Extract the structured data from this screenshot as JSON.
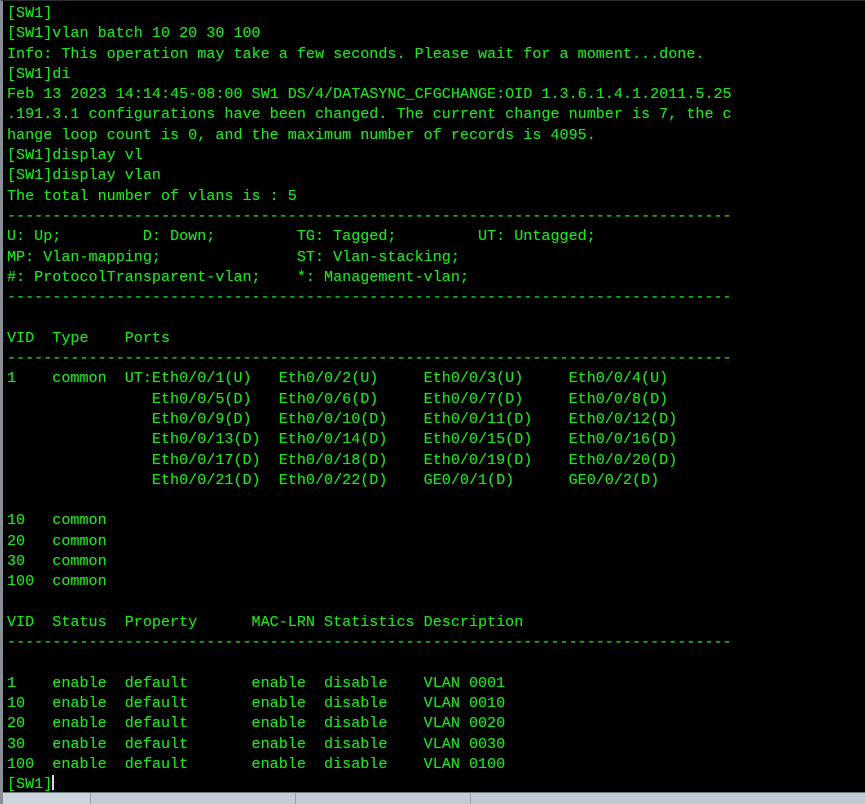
{
  "terminal": {
    "prompt": "[SW1]",
    "theme": {
      "background": "#000000",
      "foreground": "#22e022",
      "cursor": "#cfd6dd",
      "status_bar": "#b9c4d0"
    },
    "lines": [
      "[SW1]",
      "[SW1]vlan batch 10 20 30 100",
      "Info: This operation may take a few seconds. Please wait for a moment...done.",
      "[SW1]di",
      "Feb 13 2023 14:14:45-08:00 SW1 DS/4/DATASYNC_CFGCHANGE:OID 1.3.6.1.4.1.2011.5.25",
      ".191.3.1 configurations have been changed. The current change number is 7, the c",
      "hange loop count is 0, and the maximum number of records is 4095.",
      "[SW1]display vl",
      "[SW1]display vlan",
      "The total number of vlans is : 5",
      "--------------------------------------------------------------------------------",
      "U: Up;         D: Down;         TG: Tagged;         UT: Untagged;",
      "MP: Vlan-mapping;               ST: Vlan-stacking;",
      "#: ProtocolTransparent-vlan;    *: Management-vlan;",
      "--------------------------------------------------------------------------------",
      "",
      "VID  Type    Ports",
      "--------------------------------------------------------------------------------",
      "1    common  UT:Eth0/0/1(U)   Eth0/0/2(U)     Eth0/0/3(U)     Eth0/0/4(U)",
      "                Eth0/0/5(D)   Eth0/0/6(D)     Eth0/0/7(D)     Eth0/0/8(D)",
      "                Eth0/0/9(D)   Eth0/0/10(D)    Eth0/0/11(D)    Eth0/0/12(D)",
      "                Eth0/0/13(D)  Eth0/0/14(D)    Eth0/0/15(D)    Eth0/0/16(D)",
      "                Eth0/0/17(D)  Eth0/0/18(D)    Eth0/0/19(D)    Eth0/0/20(D)",
      "                Eth0/0/21(D)  Eth0/0/22(D)    GE0/0/1(D)      GE0/0/2(D)",
      "",
      "10   common",
      "20   common",
      "30   common",
      "100  common",
      "",
      "VID  Status  Property      MAC-LRN Statistics Description",
      "--------------------------------------------------------------------------------",
      "",
      "1    enable  default       enable  disable    VLAN 0001",
      "10   enable  default       enable  disable    VLAN 0010",
      "20   enable  default       enable  disable    VLAN 0020",
      "30   enable  default       enable  disable    VLAN 0030",
      "100  enable  default       enable  disable    VLAN 0100"
    ],
    "final_prompt": "[SW1]"
  },
  "command_session": {
    "commands_entered": [
      "vlan batch 10 20 30 100",
      "di",
      "display vl",
      "display vlan"
    ],
    "info_message": "Info: This operation may take a few seconds. Please wait for a moment...done.",
    "log_event": {
      "timestamp": "Feb 13 2023 14:14:45-08:00",
      "device": "SW1",
      "module": "DS/4/DATASYNC_CFGCHANGE",
      "oid": "1.3.6.1.4.1.2011.5.25.191.3.1",
      "change_number": "7",
      "change_loop_count": "0",
      "max_records": "4095"
    },
    "vlan_summary": {
      "total_label": "The total number of vlans is : 5",
      "total_count": "5"
    },
    "legend": [
      {
        "code": "U",
        "meaning": "Up"
      },
      {
        "code": "D",
        "meaning": "Down"
      },
      {
        "code": "TG",
        "meaning": "Tagged"
      },
      {
        "code": "UT",
        "meaning": "Untagged"
      },
      {
        "code": "MP",
        "meaning": "Vlan-mapping"
      },
      {
        "code": "ST",
        "meaning": "Vlan-stacking"
      },
      {
        "code": "#",
        "meaning": "ProtocolTransparent-vlan"
      },
      {
        "code": "*",
        "meaning": "Management-vlan"
      }
    ],
    "ports_table": {
      "headers": [
        "VID",
        "Type",
        "Ports"
      ],
      "rows": [
        {
          "vid": "1",
          "type": "common",
          "tag": "UT:",
          "ports": [
            "Eth0/0/1(U)",
            "Eth0/0/2(U)",
            "Eth0/0/3(U)",
            "Eth0/0/4(U)",
            "Eth0/0/5(D)",
            "Eth0/0/6(D)",
            "Eth0/0/7(D)",
            "Eth0/0/8(D)",
            "Eth0/0/9(D)",
            "Eth0/0/10(D)",
            "Eth0/0/11(D)",
            "Eth0/0/12(D)",
            "Eth0/0/13(D)",
            "Eth0/0/14(D)",
            "Eth0/0/15(D)",
            "Eth0/0/16(D)",
            "Eth0/0/17(D)",
            "Eth0/0/18(D)",
            "Eth0/0/19(D)",
            "Eth0/0/20(D)",
            "Eth0/0/21(D)",
            "Eth0/0/22(D)",
            "GE0/0/1(D)",
            "GE0/0/2(D)"
          ]
        },
        {
          "vid": "10",
          "type": "common",
          "tag": "",
          "ports": []
        },
        {
          "vid": "20",
          "type": "common",
          "tag": "",
          "ports": []
        },
        {
          "vid": "30",
          "type": "common",
          "tag": "",
          "ports": []
        },
        {
          "vid": "100",
          "type": "common",
          "tag": "",
          "ports": []
        }
      ]
    },
    "status_table": {
      "headers": [
        "VID",
        "Status",
        "Property",
        "MAC-LRN",
        "Statistics",
        "Description"
      ],
      "rows": [
        {
          "vid": "1",
          "status": "enable",
          "property": "default",
          "mac_lrn": "enable",
          "statistics": "disable",
          "description": "VLAN 0001"
        },
        {
          "vid": "10",
          "status": "enable",
          "property": "default",
          "mac_lrn": "enable",
          "statistics": "disable",
          "description": "VLAN 0010"
        },
        {
          "vid": "20",
          "status": "enable",
          "property": "default",
          "mac_lrn": "enable",
          "statistics": "disable",
          "description": "VLAN 0020"
        },
        {
          "vid": "30",
          "status": "enable",
          "property": "default",
          "mac_lrn": "enable",
          "statistics": "disable",
          "description": "VLAN 0030"
        },
        {
          "vid": "100",
          "status": "enable",
          "property": "default",
          "mac_lrn": "enable",
          "statistics": "disable",
          "description": "VLAN 0100"
        }
      ]
    }
  }
}
